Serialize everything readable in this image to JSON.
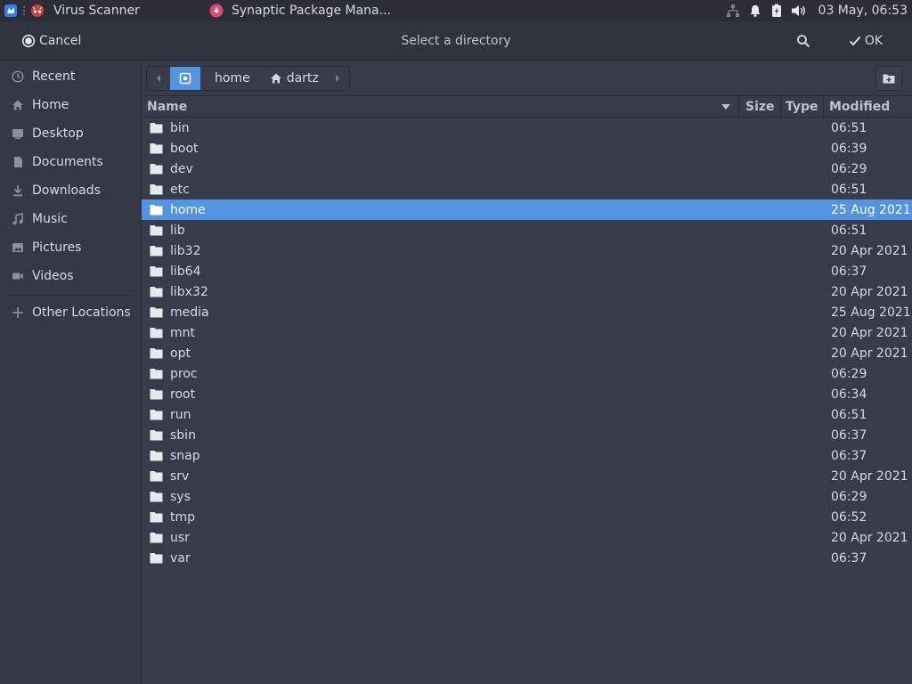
{
  "taskbar": {
    "tasks": [
      {
        "label": "Virus Scanner",
        "icon": "virus-scanner-icon"
      },
      {
        "label": "Synaptic Package Mana...",
        "icon": "synaptic-icon"
      }
    ],
    "clock": "03 May, 06:53"
  },
  "header": {
    "cancel_label": "Cancel",
    "title": "Select a directory",
    "ok_label": "OK"
  },
  "sidebar": {
    "items": [
      {
        "label": "Recent",
        "icon": "clock-icon"
      },
      {
        "label": "Home",
        "icon": "home-icon"
      },
      {
        "label": "Desktop",
        "icon": "desktop-icon"
      },
      {
        "label": "Documents",
        "icon": "document-icon"
      },
      {
        "label": "Downloads",
        "icon": "download-icon"
      },
      {
        "label": "Music",
        "icon": "music-icon"
      },
      {
        "label": "Pictures",
        "icon": "picture-icon"
      },
      {
        "label": "Videos",
        "icon": "video-icon"
      }
    ],
    "other_locations": "Other Locations"
  },
  "path": {
    "segments": [
      "home",
      "dartz"
    ]
  },
  "columns": {
    "name": "Name",
    "size": "Size",
    "type": "Type",
    "modified": "Modified"
  },
  "files": [
    {
      "name": "bin",
      "modified": "06:51"
    },
    {
      "name": "boot",
      "modified": "06:39"
    },
    {
      "name": "dev",
      "modified": "06:29"
    },
    {
      "name": "etc",
      "modified": "06:51"
    },
    {
      "name": "home",
      "modified": "25 Aug 2021",
      "selected": true
    },
    {
      "name": "lib",
      "modified": "06:51"
    },
    {
      "name": "lib32",
      "modified": "20 Apr 2021"
    },
    {
      "name": "lib64",
      "modified": "06:37"
    },
    {
      "name": "libx32",
      "modified": "20 Apr 2021"
    },
    {
      "name": "media",
      "modified": "25 Aug 2021"
    },
    {
      "name": "mnt",
      "modified": "20 Apr 2021"
    },
    {
      "name": "opt",
      "modified": "20 Apr 2021"
    },
    {
      "name": "proc",
      "modified": "06:29"
    },
    {
      "name": "root",
      "modified": "06:34"
    },
    {
      "name": "run",
      "modified": "06:51"
    },
    {
      "name": "sbin",
      "modified": "06:37"
    },
    {
      "name": "snap",
      "modified": "06:37"
    },
    {
      "name": "srv",
      "modified": "20 Apr 2021"
    },
    {
      "name": "sys",
      "modified": "06:29"
    },
    {
      "name": "tmp",
      "modified": "06:52"
    },
    {
      "name": "usr",
      "modified": "20 Apr 2021"
    },
    {
      "name": "var",
      "modified": "06:37"
    }
  ],
  "colors": {
    "accent": "#5294e2",
    "background": "#383c4a",
    "sidebar": "#353945",
    "header": "#2f343f",
    "text": "#d3dae3"
  }
}
